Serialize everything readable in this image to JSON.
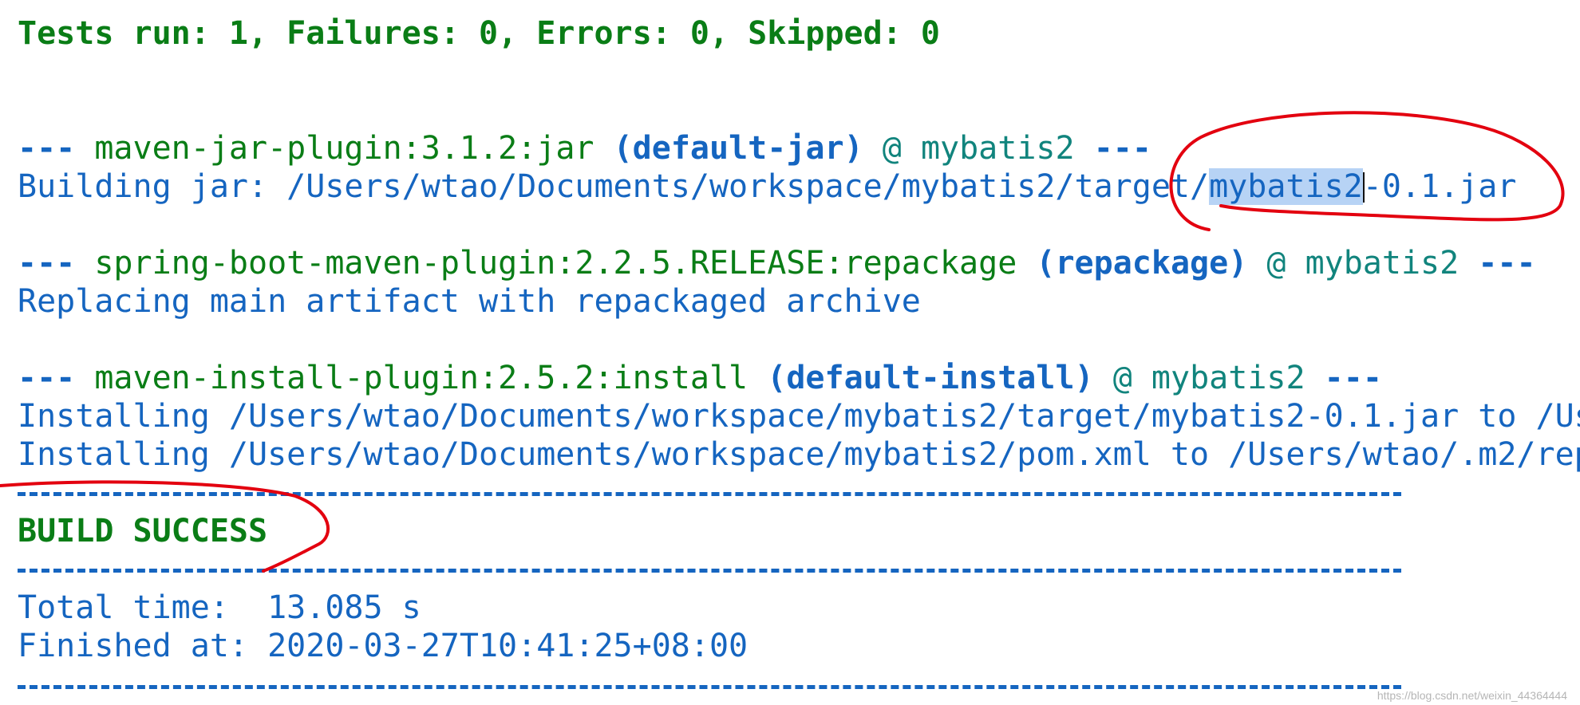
{
  "console": {
    "tests_summary": "Tests run: 1, Failures: 0, Errors: 0, Skipped: 0",
    "jar_plugin": {
      "dashes": "---",
      "plugin": "maven-jar-plugin:3.1.2:jar",
      "execution": "(default-jar)",
      "at": "@",
      "artifact": "mybatis2",
      "dashes_end": "---"
    },
    "building_jar": {
      "prefix": "Building jar: /Users/wtao/Documents/workspace/mybatis2/target/",
      "selected": "mybatis2",
      "suffix": "-0.1.jar"
    },
    "repackage_plugin": {
      "dashes": "---",
      "plugin": "spring-boot-maven-plugin:2.2.5.RELEASE:repackage",
      "execution": "(repackage)",
      "at": "@",
      "artifact": "mybatis2",
      "dashes_end": "---"
    },
    "replacing_line": "Replacing main artifact with repackaged archive",
    "install_plugin": {
      "dashes": "---",
      "plugin": "maven-install-plugin:2.5.2:install",
      "execution": "(default-install)",
      "at": "@",
      "artifact": "mybatis2",
      "dashes_end": "---"
    },
    "installing_jar_line": "Installing /Users/wtao/Documents/workspace/mybatis2/target/mybatis2-0.1.jar to /Us",
    "installing_pom_line": "Installing /Users/wtao/Documents/workspace/mybatis2/pom.xml to /Users/wtao/.m2/rep",
    "build_status": "BUILD SUCCESS",
    "total_time": "Total time:  13.085 s",
    "finished_at": "Finished at: 2020-03-27T10:41:25+08:00"
  },
  "watermark": "https://blog.csdn.net/weixin_44364444",
  "colors": {
    "info_blue": "#1565c0",
    "success_green": "#0a7d16",
    "artifact_teal": "#11847d",
    "selection": "#b7d3f5",
    "annotation_red": "#e3000f"
  }
}
